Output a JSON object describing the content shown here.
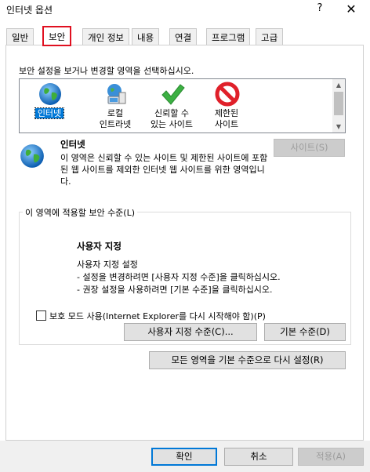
{
  "window": {
    "title": "인터넷 옵션",
    "help_label": "?",
    "close_label": "✕"
  },
  "tabs": [
    {
      "label": "일반"
    },
    {
      "label": "보안",
      "active": true
    },
    {
      "label": "개인 정보"
    },
    {
      "label": "내용"
    },
    {
      "label": "연결"
    },
    {
      "label": "프로그램"
    },
    {
      "label": "고급"
    }
  ],
  "security": {
    "instruction": "보안 설정을 보거나 변경할 영역을 선택하십시오.",
    "zones": [
      {
        "label": "인터넷",
        "icon": "globe-icon",
        "selected": true
      },
      {
        "label": "로컬\n인트라넷",
        "icon": "intranet-icon"
      },
      {
        "label": "신뢰할 수\n있는 사이트",
        "icon": "checkmark-icon"
      },
      {
        "label": "제한된\n사이트",
        "icon": "restricted-icon"
      }
    ],
    "selected_zone": {
      "name": "인터넷",
      "description": "이 영역은 신뢰할 수 있는 사이트 및 제한된 사이트에 포함된 웹 사이트를 제외한 인터넷 웹 사이트를 위한 영역입니다."
    },
    "sites_button": "사이트(S)",
    "level_group_title": "이 영역에 적용할 보안 수준(L)",
    "level": {
      "title": "사용자 지정",
      "lines": [
        "사용자 지정 설정",
        "- 설정을 변경하려면 [사용자 지정 수준]을 클릭하십시오.",
        "- 권장 설정을 사용하려면 [기본 수준]을 클릭하십시오."
      ]
    },
    "protected_mode_label": "보호 모드 사용(Internet Explorer를 다시 시작해야 함)(P)",
    "protected_mode_checked": false,
    "custom_level_button": "사용자 지정 수준(C)...",
    "default_level_button": "기본 수준(D)",
    "reset_all_button": "모든 영역을 기본 수준으로 다시 설정(R)"
  },
  "footer": {
    "ok_button": "확인",
    "cancel_button": "취소",
    "apply_button": "적용(A)"
  },
  "colors": {
    "selection": "#0078d7",
    "active_tab_highlight": "#e01020"
  }
}
